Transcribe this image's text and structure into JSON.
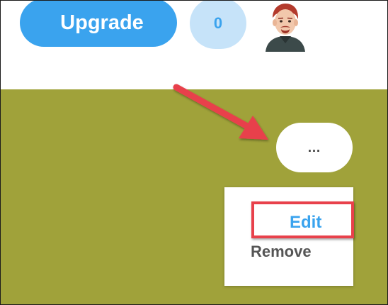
{
  "header": {
    "upgrade_label": "Upgrade",
    "count": "0",
    "avatar_icon": "user-avatar-icon"
  },
  "card": {
    "more_label": "...",
    "menu": {
      "items": [
        {
          "label": "Edit"
        },
        {
          "label": "Remove"
        }
      ]
    }
  },
  "colors": {
    "accent_blue": "#3aa3ee",
    "badge_blue": "#c6e3f9",
    "olive_background": "#a0a23a",
    "annotation_red": "#e8414b"
  }
}
